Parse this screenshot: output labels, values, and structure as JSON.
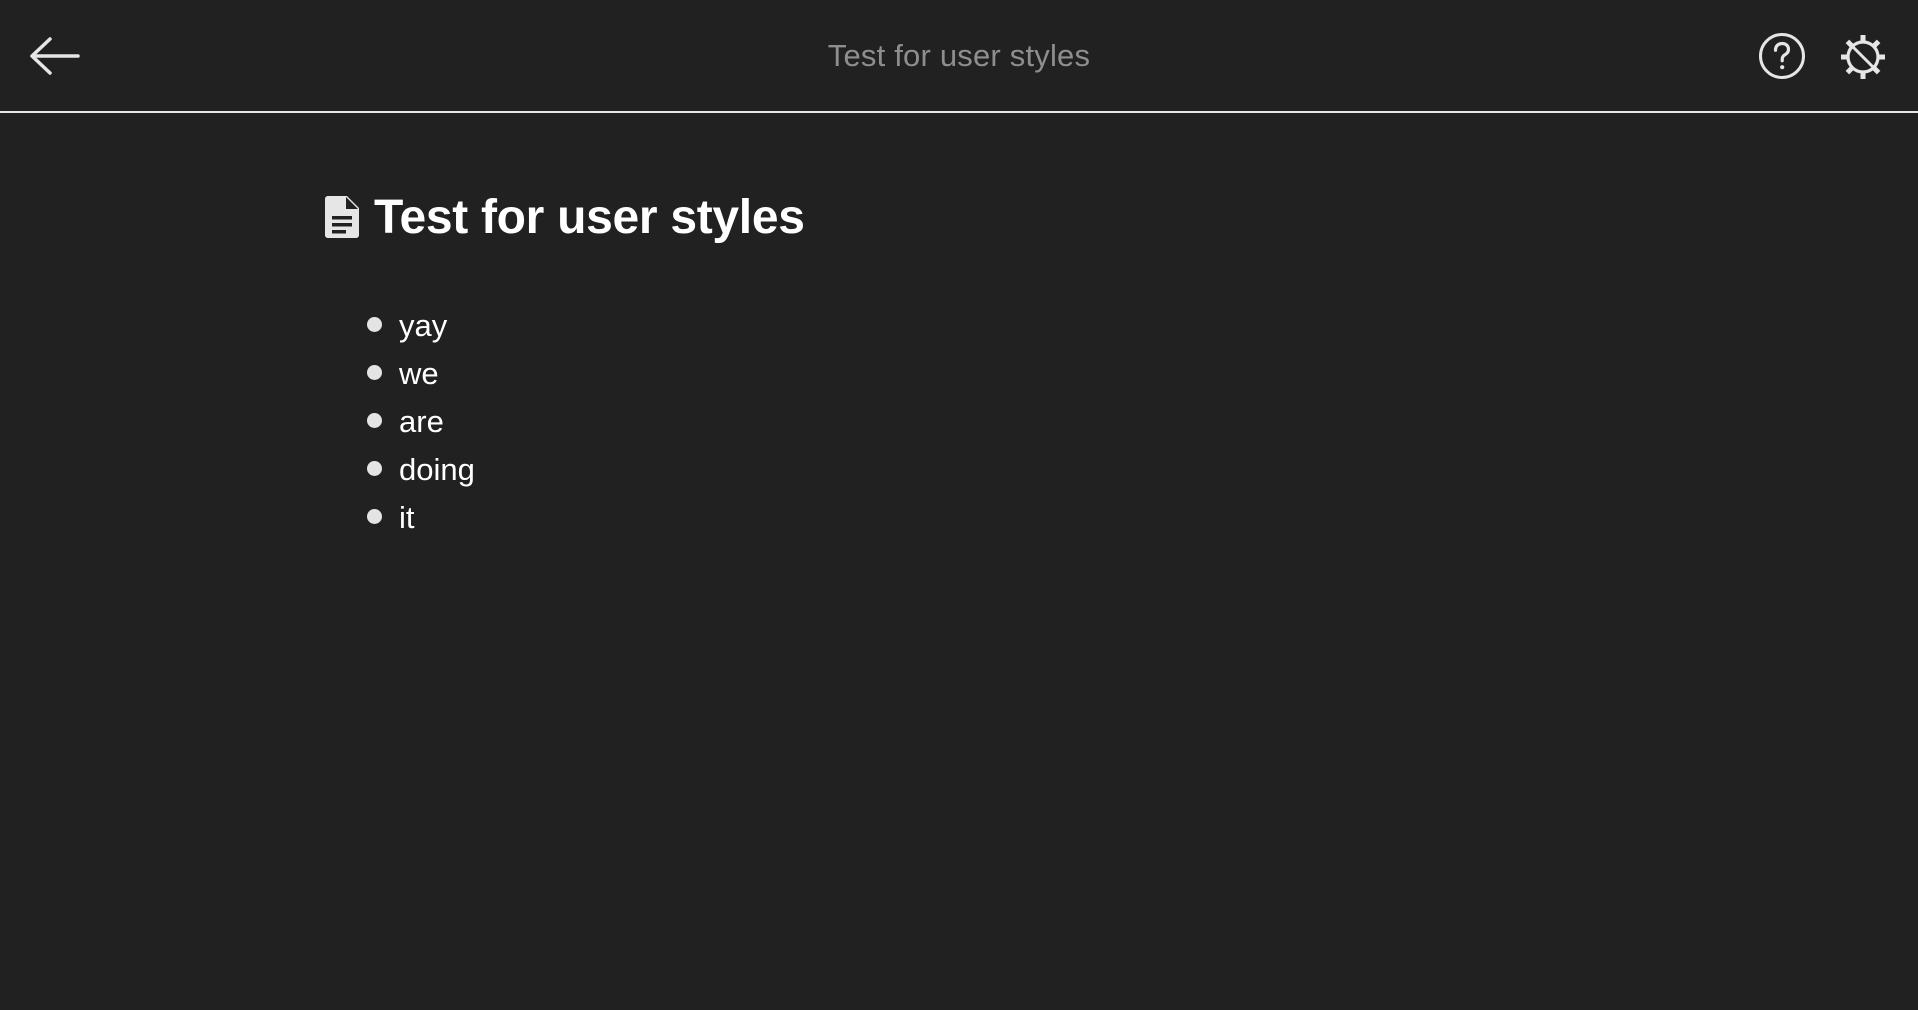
{
  "header": {
    "title": "Test for user styles",
    "back_icon": "arrow-left-icon",
    "help_icon": "question-circle-icon",
    "settings_icon": "gear-icon"
  },
  "document": {
    "icon": "document-icon",
    "title": "Test for user styles",
    "items": [
      "yay",
      "we",
      "are",
      "doing",
      "it"
    ]
  },
  "colors": {
    "background": "#212121",
    "header_title": "#8e8e8e",
    "text": "#ffffff",
    "divider": "#e6e6e6",
    "bullet": "#e4e4e4"
  }
}
